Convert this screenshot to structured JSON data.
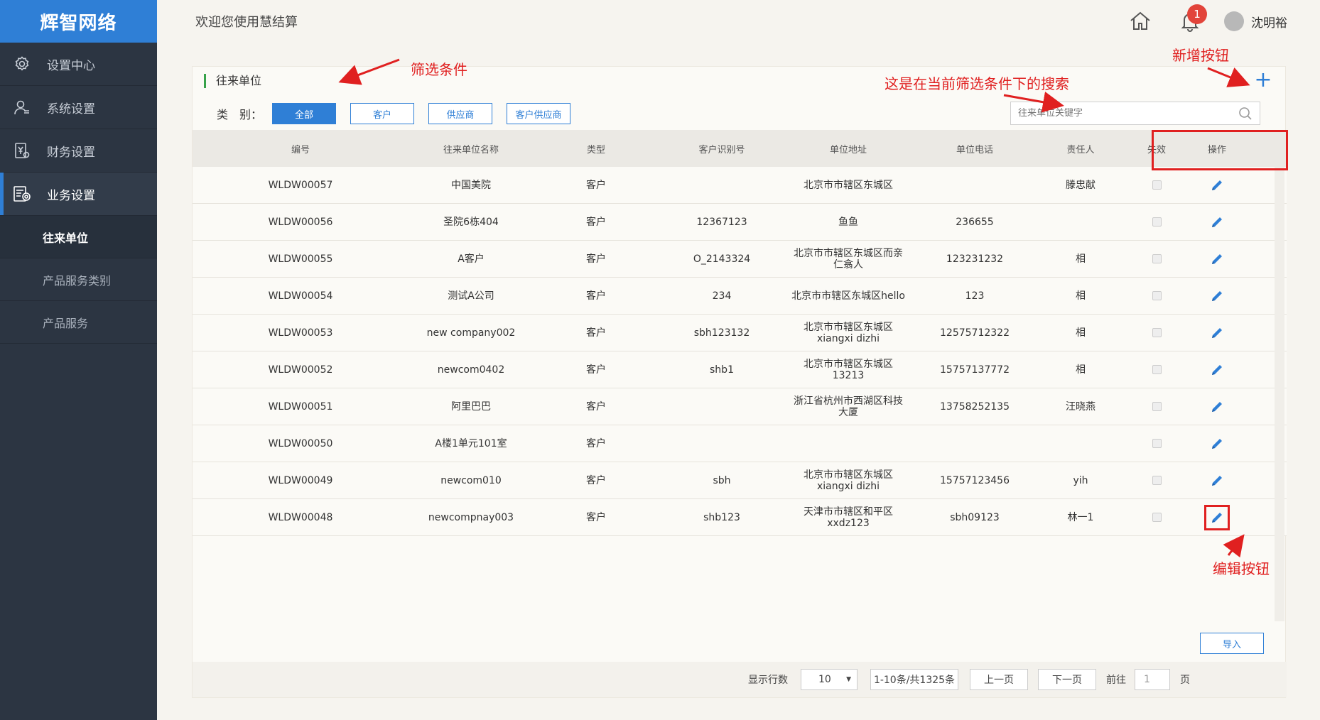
{
  "sidebar": {
    "brand": "辉智网络",
    "items": [
      {
        "label": "设置中心",
        "icon": "gear-icon"
      },
      {
        "label": "系统设置",
        "icon": "user-icon"
      },
      {
        "label": "财务设置",
        "icon": "finance-doc-icon"
      },
      {
        "label": "业务设置",
        "icon": "business-icon"
      }
    ],
    "sub_items": [
      {
        "label": "往来单位"
      },
      {
        "label": "产品服务类别"
      },
      {
        "label": "产品服务"
      }
    ]
  },
  "header": {
    "welcome": "欢迎您使用慧结算",
    "notifications": "1",
    "user_name": "沈明裕"
  },
  "panel": {
    "title": "往来单位",
    "filter": {
      "label": "类　别：",
      "options": [
        "全部",
        "客户",
        "供应商",
        "客户供应商"
      ],
      "selected": "全部"
    },
    "search_placeholder": "往来单位关键字",
    "columns": [
      "编号",
      "往来单位名称",
      "类型",
      "客户识别号",
      "单位地址",
      "单位电话",
      "责任人",
      "失效",
      "操作"
    ],
    "rows": [
      {
        "code": "WLDW00057",
        "name": "中国美院",
        "type": "客户",
        "tax_id": "",
        "address": "北京市市辖区东城区",
        "phone": "",
        "owner": "滕忠献"
      },
      {
        "code": "WLDW00056",
        "name": "圣院6栋404",
        "type": "客户",
        "tax_id": "12367123",
        "address": "鱼鱼",
        "phone": "236655",
        "owner": ""
      },
      {
        "code": "WLDW00055",
        "name": "A客户",
        "type": "客户",
        "tax_id": "O_2143324",
        "address": "北京市市辖区东城区而亲仁翕人",
        "phone": "123231232",
        "owner": "相"
      },
      {
        "code": "WLDW00054",
        "name": "测试A公司",
        "type": "客户",
        "tax_id": "234",
        "address": "北京市市辖区东城区hello",
        "phone": "123",
        "owner": "相"
      },
      {
        "code": "WLDW00053",
        "name": "new company002",
        "type": "客户",
        "tax_id": "sbh123132",
        "address": "北京市市辖区东城区xiangxi dizhi",
        "phone": "12575712322",
        "owner": "相"
      },
      {
        "code": "WLDW00052",
        "name": "newcom0402",
        "type": "客户",
        "tax_id": "shb1",
        "address": "北京市市辖区东城区13213",
        "phone": "15757137772",
        "owner": "相"
      },
      {
        "code": "WLDW00051",
        "name": "阿里巴巴",
        "type": "客户",
        "tax_id": "",
        "address": "浙江省杭州市西湖区科技大厦",
        "phone": "13758252135",
        "owner": "汪晓燕"
      },
      {
        "code": "WLDW00050",
        "name": "A楼1单元101室",
        "type": "客户",
        "tax_id": "",
        "address": "",
        "phone": "",
        "owner": ""
      },
      {
        "code": "WLDW00049",
        "name": "newcom010",
        "type": "客户",
        "tax_id": "sbh",
        "address": "北京市市辖区东城区xiangxi dizhi",
        "phone": "15757123456",
        "owner": "yih"
      },
      {
        "code": "WLDW00048",
        "name": "newcompnay003",
        "type": "客户",
        "tax_id": "shb123",
        "address": "天津市市辖区和平区xxdz123",
        "phone": "sbh09123",
        "owner": "林一1"
      }
    ],
    "import_label": "导入",
    "pagination": {
      "rows_label": "显示行数",
      "rows_value": "10",
      "summary": "1-10条/共1325条",
      "prev": "上一页",
      "next": "下一页",
      "goto_label": "前往",
      "goto_placeholder": "1",
      "page_suffix": "页"
    }
  },
  "annotations": {
    "filter": "筛选条件",
    "search": "这是在当前筛选条件下的搜索",
    "add": "新增按钮",
    "edit": "编辑按钮"
  },
  "colors": {
    "accent": "#2f7fd6",
    "sidebar": "#2c3542",
    "annotation": "#e02020",
    "badge": "#e2443a"
  }
}
